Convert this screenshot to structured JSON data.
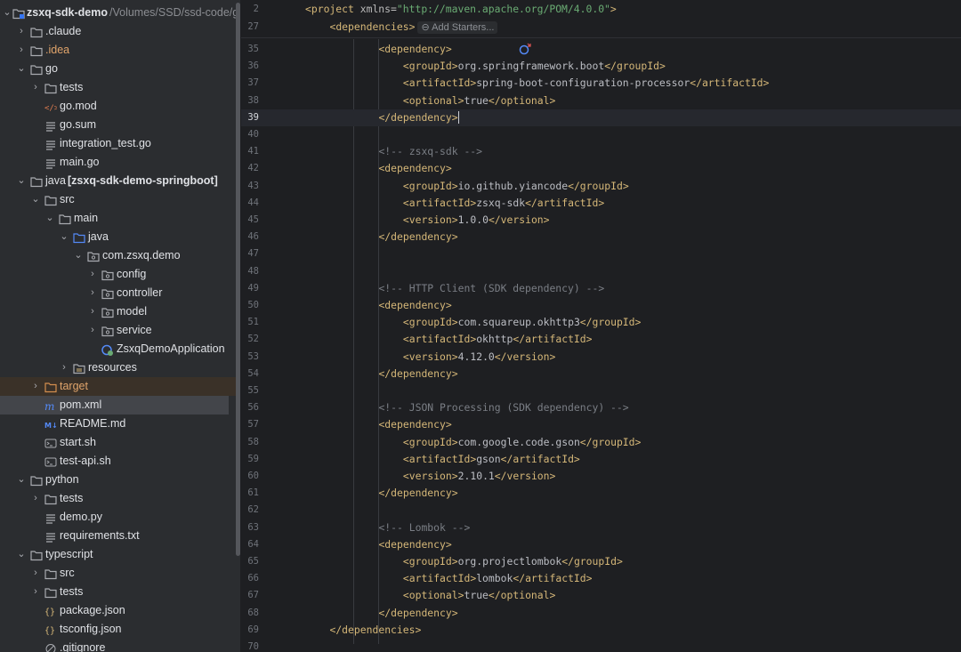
{
  "project_tree": {
    "root": {
      "name": "zsxq-sdk-demo",
      "path": "/Volumes/SSD/ssd-code/git"
    },
    "items": [
      {
        "label": ".claude",
        "kind": "folder",
        "chevron": "›"
      },
      {
        "label": ".idea",
        "kind": "folder",
        "chevron": "›"
      },
      {
        "label": "go",
        "kind": "folder",
        "chevron": "⌄"
      },
      {
        "label": "tests",
        "kind": "folder",
        "chevron": "›"
      },
      {
        "label": "go.mod",
        "kind": "gomod"
      },
      {
        "label": "go.sum",
        "kind": "text"
      },
      {
        "label": "integration_test.go",
        "kind": "text"
      },
      {
        "label": "main.go",
        "kind": "text"
      },
      {
        "label": "java",
        "module": "[zsxq-sdk-demo-springboot]",
        "kind": "folder",
        "chevron": "⌄"
      },
      {
        "label": "src",
        "kind": "folder",
        "chevron": "⌄"
      },
      {
        "label": "main",
        "kind": "folder",
        "chevron": "⌄"
      },
      {
        "label": "java",
        "kind": "src-folder",
        "chevron": "⌄"
      },
      {
        "label": "com.zsxq.demo",
        "kind": "package",
        "chevron": "⌄"
      },
      {
        "label": "config",
        "kind": "package",
        "chevron": "›"
      },
      {
        "label": "controller",
        "kind": "package",
        "chevron": "›"
      },
      {
        "label": "model",
        "kind": "package",
        "chevron": "›"
      },
      {
        "label": "service",
        "kind": "package",
        "chevron": "›"
      },
      {
        "label": "ZsxqDemoApplication",
        "kind": "springboot"
      },
      {
        "label": "resources",
        "kind": "resources",
        "chevron": "›"
      },
      {
        "label": "target",
        "kind": "excluded",
        "chevron": "›"
      },
      {
        "label": "pom.xml",
        "kind": "maven"
      },
      {
        "label": "README.md",
        "kind": "markdown"
      },
      {
        "label": "start.sh",
        "kind": "shell"
      },
      {
        "label": "test-api.sh",
        "kind": "shell"
      },
      {
        "label": "python",
        "kind": "folder",
        "chevron": "⌄"
      },
      {
        "label": "tests",
        "kind": "folder",
        "chevron": "›"
      },
      {
        "label": "demo.py",
        "kind": "text"
      },
      {
        "label": "requirements.txt",
        "kind": "text"
      },
      {
        "label": "typescript",
        "kind": "folder",
        "chevron": "⌄"
      },
      {
        "label": "src",
        "kind": "folder",
        "chevron": "›"
      },
      {
        "label": "tests",
        "kind": "folder",
        "chevron": "›"
      },
      {
        "label": "package.json",
        "kind": "json"
      },
      {
        "label": "tsconfig.json",
        "kind": "json"
      },
      {
        "label": ".gitignore",
        "kind": "ignore"
      }
    ]
  },
  "editor": {
    "add_starters": "Add Starters...",
    "sticky": [
      {
        "num": "2",
        "tokens": [
          [
            "tag",
            "<project "
          ],
          [
            "attr",
            "xmlns="
          ],
          [
            "aval",
            "\"http://maven.apache.org/POM/4.0.0\""
          ],
          [
            "tag",
            ">"
          ]
        ]
      },
      {
        "num": "27",
        "tokens": [
          [
            "tag",
            "<dependencies>"
          ]
        ]
      }
    ],
    "lines": [
      {
        "num": "35",
        "tokens": [
          [
            "tag",
            "<dependency>"
          ]
        ]
      },
      {
        "num": "36",
        "tokens": [
          [
            "tag",
            "<groupId>"
          ],
          [
            "txt",
            "org.springframework.boot"
          ],
          [
            "tag",
            "</groupId>"
          ]
        ]
      },
      {
        "num": "37",
        "tokens": [
          [
            "tag",
            "<artifactId>"
          ],
          [
            "txt",
            "spring-boot-configuration-processor"
          ],
          [
            "tag",
            "</artifactId>"
          ]
        ]
      },
      {
        "num": "38",
        "tokens": [
          [
            "tag",
            "<optional>"
          ],
          [
            "txt",
            "true"
          ],
          [
            "tag",
            "</optional>"
          ]
        ]
      },
      {
        "num": "39",
        "tokens": [
          [
            "tag",
            "</dependency>"
          ]
        ]
      },
      {
        "num": "40",
        "tokens": []
      },
      {
        "num": "41",
        "tokens": [
          [
            "cmt",
            "<!-- zsxq-sdk -->"
          ]
        ]
      },
      {
        "num": "42",
        "tokens": [
          [
            "tag",
            "<dependency>"
          ]
        ]
      },
      {
        "num": "43",
        "tokens": [
          [
            "tag",
            "<groupId>"
          ],
          [
            "txt",
            "io.github.yiancode"
          ],
          [
            "tag",
            "</groupId>"
          ]
        ]
      },
      {
        "num": "44",
        "tokens": [
          [
            "tag",
            "<artifactId>"
          ],
          [
            "txt",
            "zsxq-sdk"
          ],
          [
            "tag",
            "</artifactId>"
          ]
        ]
      },
      {
        "num": "45",
        "tokens": [
          [
            "tag",
            "<version>"
          ],
          [
            "txt",
            "1.0.0"
          ],
          [
            "tag",
            "</version>"
          ]
        ]
      },
      {
        "num": "46",
        "tokens": [
          [
            "tag",
            "</dependency>"
          ]
        ]
      },
      {
        "num": "47",
        "tokens": []
      },
      {
        "num": "48",
        "tokens": []
      },
      {
        "num": "49",
        "tokens": [
          [
            "cmt",
            "<!-- HTTP Client (SDK dependency) -->"
          ]
        ]
      },
      {
        "num": "50",
        "tokens": [
          [
            "tag",
            "<dependency>"
          ]
        ]
      },
      {
        "num": "51",
        "tokens": [
          [
            "tag",
            "<groupId>"
          ],
          [
            "txt",
            "com.squareup.okhttp3"
          ],
          [
            "tag",
            "</groupId>"
          ]
        ]
      },
      {
        "num": "52",
        "tokens": [
          [
            "tag",
            "<artifactId>"
          ],
          [
            "txt",
            "okhttp"
          ],
          [
            "tag",
            "</artifactId>"
          ]
        ]
      },
      {
        "num": "53",
        "tokens": [
          [
            "tag",
            "<version>"
          ],
          [
            "txt",
            "4.12.0"
          ],
          [
            "tag",
            "</version>"
          ]
        ]
      },
      {
        "num": "54",
        "tokens": [
          [
            "tag",
            "</dependency>"
          ]
        ]
      },
      {
        "num": "55",
        "tokens": []
      },
      {
        "num": "56",
        "tokens": [
          [
            "cmt",
            "<!-- JSON Processing (SDK dependency) -->"
          ]
        ]
      },
      {
        "num": "57",
        "tokens": [
          [
            "tag",
            "<dependency>"
          ]
        ]
      },
      {
        "num": "58",
        "tokens": [
          [
            "tag",
            "<groupId>"
          ],
          [
            "txt",
            "com.google.code.gson"
          ],
          [
            "tag",
            "</groupId>"
          ]
        ]
      },
      {
        "num": "59",
        "tokens": [
          [
            "tag",
            "<artifactId>"
          ],
          [
            "txt",
            "gson"
          ],
          [
            "tag",
            "</artifactId>"
          ]
        ]
      },
      {
        "num": "60",
        "tokens": [
          [
            "tag",
            "<version>"
          ],
          [
            "txt",
            "2.10.1"
          ],
          [
            "tag",
            "</version>"
          ]
        ]
      },
      {
        "num": "61",
        "tokens": [
          [
            "tag",
            "</dependency>"
          ]
        ]
      },
      {
        "num": "62",
        "tokens": []
      },
      {
        "num": "63",
        "tokens": [
          [
            "cmt",
            "<!-- Lombok -->"
          ]
        ]
      },
      {
        "num": "64",
        "tokens": [
          [
            "tag",
            "<dependency>"
          ]
        ]
      },
      {
        "num": "65",
        "tokens": [
          [
            "tag",
            "<groupId>"
          ],
          [
            "txt",
            "org.projectlombok"
          ],
          [
            "tag",
            "</groupId>"
          ]
        ]
      },
      {
        "num": "66",
        "tokens": [
          [
            "tag",
            "<artifactId>"
          ],
          [
            "txt",
            "lombok"
          ],
          [
            "tag",
            "</artifactId>"
          ]
        ]
      },
      {
        "num": "67",
        "tokens": [
          [
            "tag",
            "<optional>"
          ],
          [
            "txt",
            "true"
          ],
          [
            "tag",
            "</optional>"
          ]
        ]
      },
      {
        "num": "68",
        "tokens": [
          [
            "tag",
            "</dependency>"
          ]
        ]
      },
      {
        "num": "69",
        "tokens": [
          [
            "tag",
            "</dependencies>"
          ]
        ]
      },
      {
        "num": "70",
        "tokens": []
      }
    ]
  }
}
